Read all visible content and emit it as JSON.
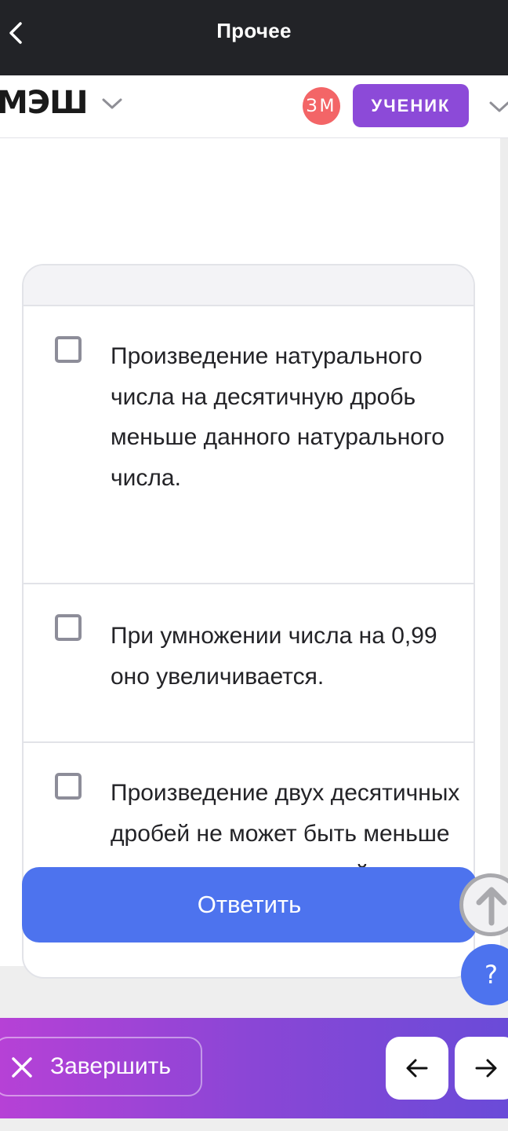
{
  "topbar": {
    "title": "Прочее",
    "back_icon": "chevron-left-icon"
  },
  "header": {
    "logo": "МЭШ",
    "avatar_initials": "ЗМ",
    "role": "УЧЕНИК"
  },
  "options": [
    {
      "text": "Произведение натурального числа на десятичную дробь меньше данного натурального числа.",
      "checked": false
    },
    {
      "text": "При умножении числа на 0,99 оно увеличивается.",
      "checked": false
    },
    {
      "text": "Произведение двух десятичных дробей не может быть меньше каждого из множителей.",
      "checked": false
    }
  ],
  "answer_button": "Ответить",
  "help_button": "?",
  "bottom_bar": {
    "finish_label": "Завершить",
    "prev_icon": "arrow-left-icon",
    "next_icon": "arrow-right-icon"
  },
  "colors": {
    "accent": "#4d73ee",
    "role_badge": "#8c4ad8",
    "avatar": "#f36567",
    "topbar": "#222327"
  }
}
